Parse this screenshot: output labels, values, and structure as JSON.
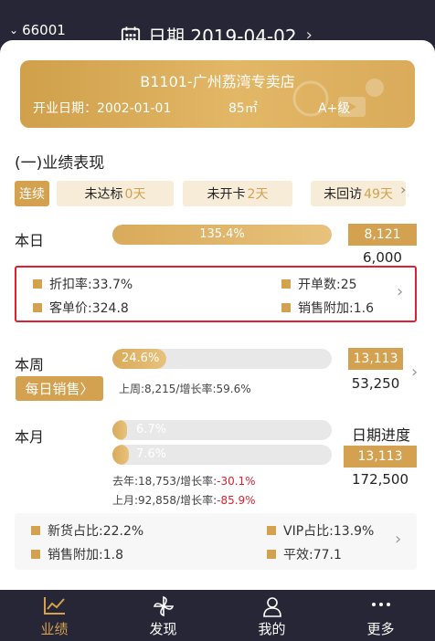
{
  "header": {
    "store_code": "66001",
    "date_label": "日期 2019-04-02"
  },
  "store": {
    "name": "B1101-广州荔湾专卖店",
    "open_date": "开业日期：2002-01-01",
    "area": "85㎡",
    "level": "A+级"
  },
  "section_title": "(一)业绩表现",
  "tags": {
    "streak": "连续",
    "items": [
      {
        "label": "未达标",
        "value": "0天"
      },
      {
        "label": "未开卡",
        "value": "2天"
      },
      {
        "label": "未回访",
        "value": "49天"
      }
    ]
  },
  "today": {
    "label": "本日",
    "percent_text": "135.4%",
    "progress": 1.0,
    "actual": "8,121",
    "target": "6,000",
    "metrics": [
      {
        "text": "折扣率:33.7%"
      },
      {
        "text": "开单数:25"
      },
      {
        "text": "客单价:324.8"
      },
      {
        "text": "销售附加:1.6"
      }
    ]
  },
  "week": {
    "label": "本周",
    "percent_text": "24.6%",
    "progress": 0.246,
    "actual": "13,113",
    "target": "53,250",
    "button": "每日销售〉",
    "note": "上周:8,215/增长率:59.6%"
  },
  "month": {
    "label": "本月",
    "bar1_text": "6.7%",
    "bar1_progress": 0.067,
    "bar2_text": "7.6%",
    "bar2_progress": 0.076,
    "progress_title": "日期进度",
    "actual": "13,113",
    "target": "172,500",
    "note1_prefix": "去年:18,753/增长率:",
    "note1_value": "-30.1%",
    "note2_prefix": "上月:92,858/增长率:",
    "note2_value": "-85.9%",
    "metrics": [
      {
        "text": "新货占比:22.2%"
      },
      {
        "text": "VIP占比:13.9%"
      },
      {
        "text": "销售附加:1.8"
      },
      {
        "text": "平效:77.1"
      }
    ]
  },
  "tabbar": {
    "items": [
      {
        "label": "业绩",
        "icon": "chart-icon"
      },
      {
        "label": "发现",
        "icon": "pinwheel-icon"
      },
      {
        "label": "我的",
        "icon": "person-icon"
      },
      {
        "label": "更多",
        "icon": "more-icon"
      }
    ]
  },
  "colors": {
    "accent": "#d4a150",
    "dark": "#262637",
    "highlight": "#e0202e"
  }
}
